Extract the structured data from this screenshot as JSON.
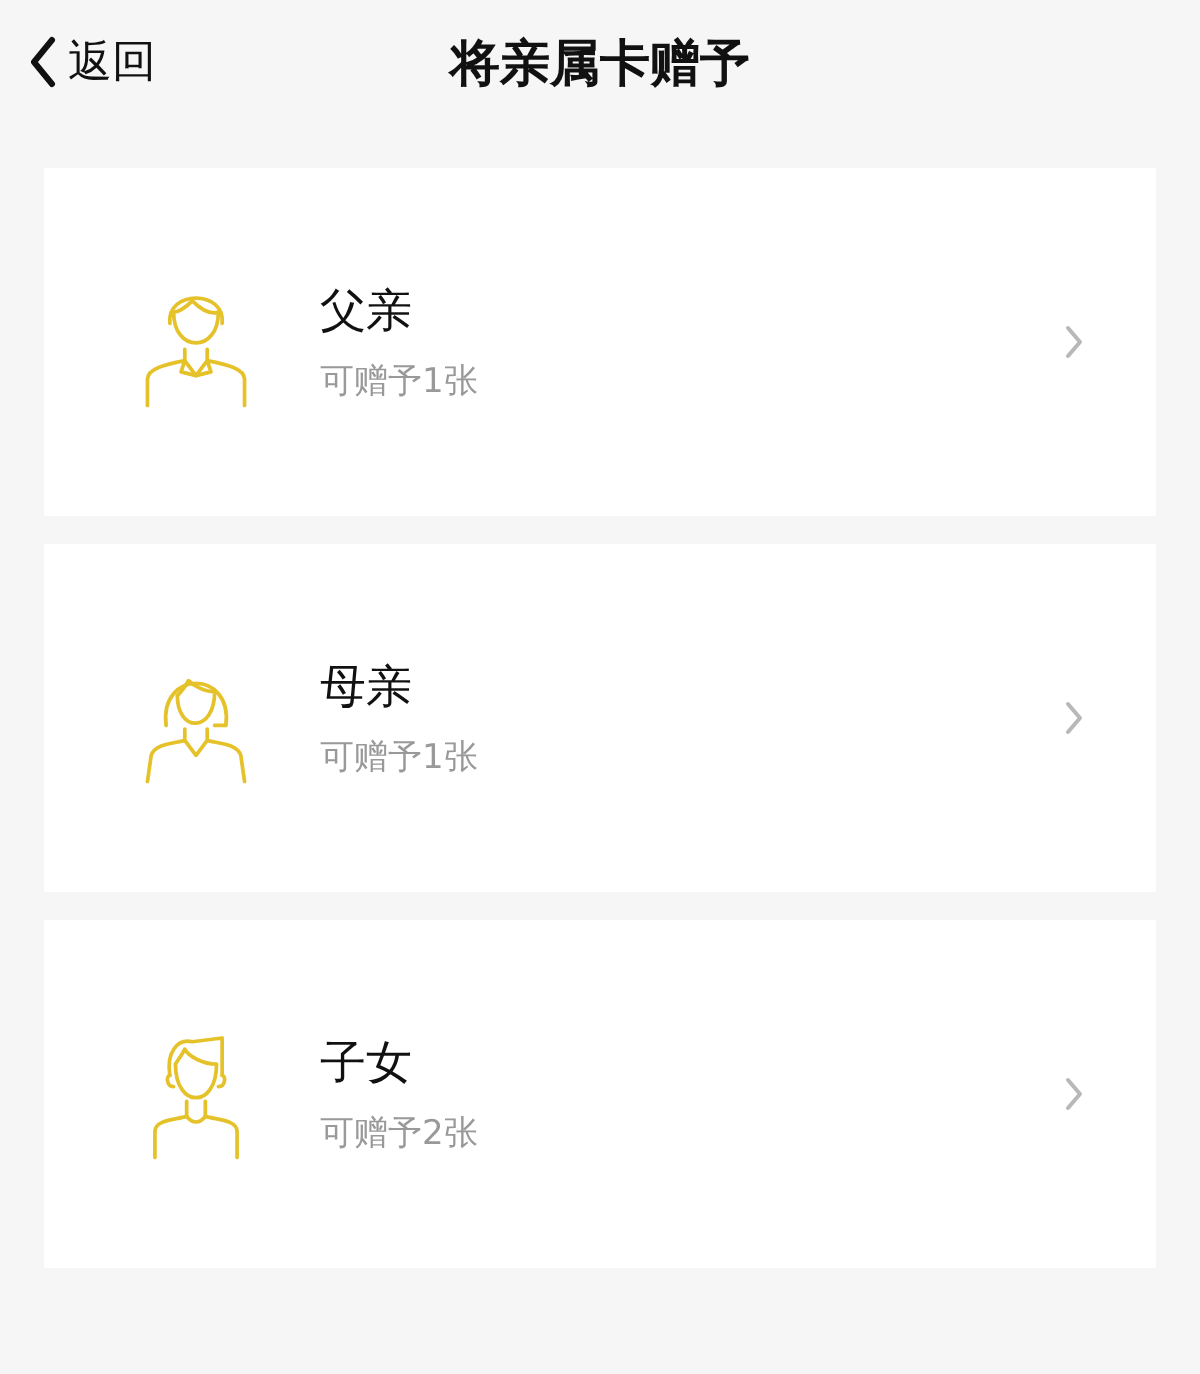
{
  "nav_bar": {
    "back": "返回",
    "title": "将亲属卡赠予"
  },
  "recipients": [
    {
      "kind": "man",
      "name": "父亲",
      "quota": "可赠予1张"
    },
    {
      "kind": "woman",
      "name": "母亲",
      "quota": "可赠予1张"
    },
    {
      "kind": "child",
      "name": "子女",
      "quota": "可赠予2张"
    }
  ]
}
